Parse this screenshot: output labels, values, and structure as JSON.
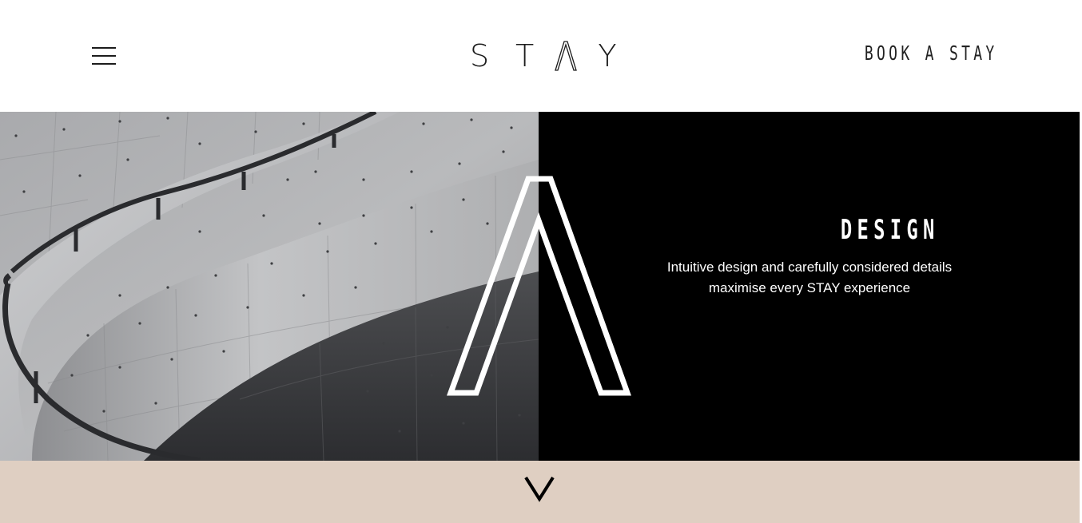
{
  "header": {
    "menu_icon": "hamburger-menu-icon",
    "logo": {
      "letters": [
        "S",
        "T",
        "Λ",
        "Y"
      ]
    },
    "book_label": "BOOK A STAY"
  },
  "hero": {
    "image_alt": "Curved concrete staircase",
    "title": "DESIGN",
    "description": "Intuitive design and carefully considered details maximise every STAY experience",
    "emblem_icon": "outlined-a-chevron-icon"
  },
  "footer_band": {
    "scroll_icon": "chevron-down-icon"
  },
  "colors": {
    "panel": "#000000",
    "band": "#dfcfc2",
    "text_dark": "#1c1c1c",
    "text_light": "#ffffff"
  }
}
